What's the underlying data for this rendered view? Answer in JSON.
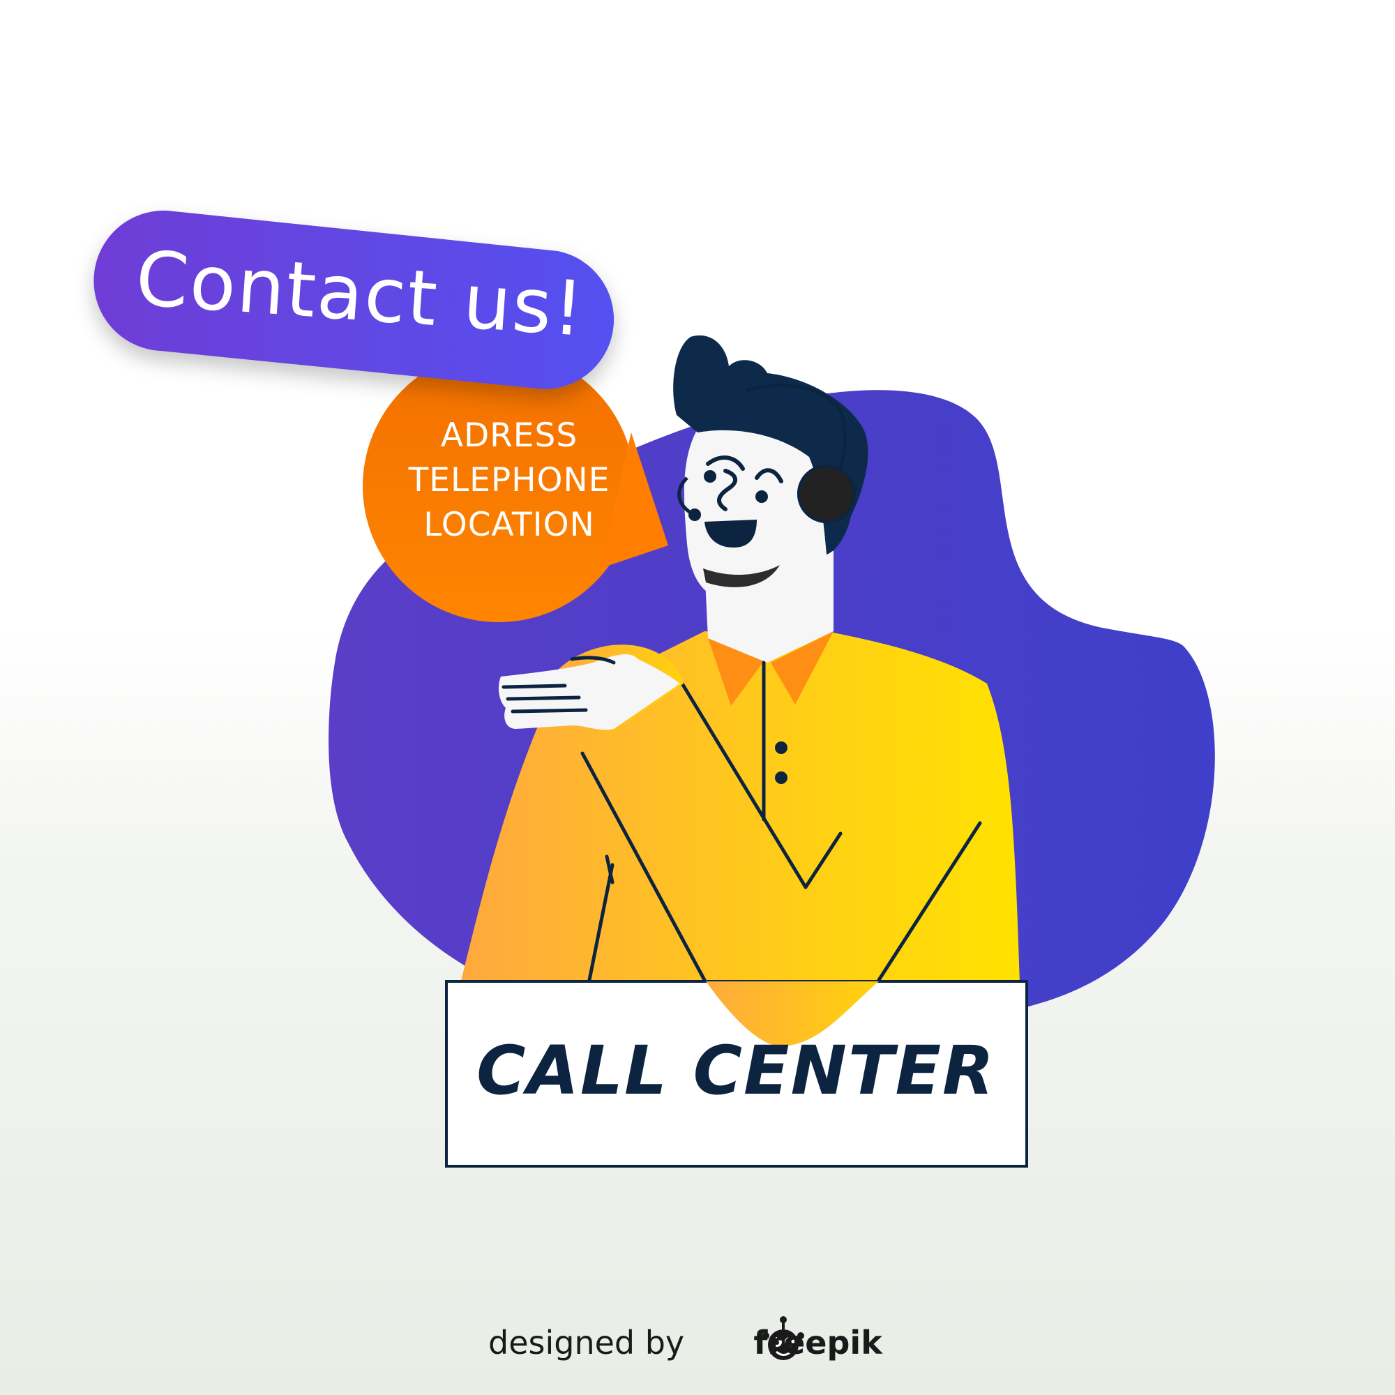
{
  "headline": "Contact us!",
  "info_lines": [
    "ADRESS",
    "TELEPHONE",
    "LOCATION"
  ],
  "sign_label": "CALL CENTER",
  "credit": {
    "prefix": "designed by",
    "brand": "freepik"
  },
  "colors": {
    "blob_purple": "#5a3ec8",
    "blob_blue": "#3f3fc9",
    "pill_start": "#6f3dd6",
    "pill_end": "#5451f0",
    "bubble_orange": "#ff7a00",
    "shirt_orange": "#ffab3d",
    "shirt_yellow": "#ffe000",
    "ink_navy": "#0c2440",
    "skin": "#f6f6f6"
  },
  "icons": {
    "headset": "headset-icon",
    "brand_logo": "freepik-logo-icon"
  }
}
